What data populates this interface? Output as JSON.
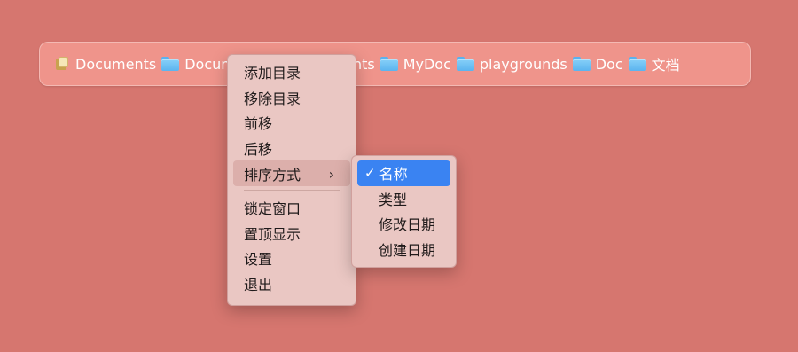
{
  "colors": {
    "background": "#d6766f",
    "bar": "#ef948b",
    "menu": "#eac7c3",
    "selection": "#3a83f2"
  },
  "breadcrumbs": [
    {
      "label": "Documents",
      "icon": "document-stack-icon"
    },
    {
      "label": "Documents",
      "icon": "folder-icon"
    },
    {
      "label": "Documents",
      "icon": "folder-icon"
    },
    {
      "label": "MyDoc",
      "icon": "folder-icon"
    },
    {
      "label": "playgrounds",
      "icon": "folder-icon"
    },
    {
      "label": "Doc",
      "icon": "folder-icon"
    },
    {
      "label": "文档",
      "icon": "folder-icon"
    }
  ],
  "context_menu": {
    "items": [
      "添加目录",
      "移除目录",
      "前移",
      "后移",
      "排序方式"
    ],
    "submenu_chevron": "›",
    "items_after_separator": [
      "锁定窗口",
      "置顶显示",
      "设置",
      "退出"
    ]
  },
  "sort_submenu": {
    "check_mark": "✓",
    "items": [
      "名称",
      "类型",
      "修改日期",
      "创建日期"
    ],
    "selected_index": 0
  }
}
